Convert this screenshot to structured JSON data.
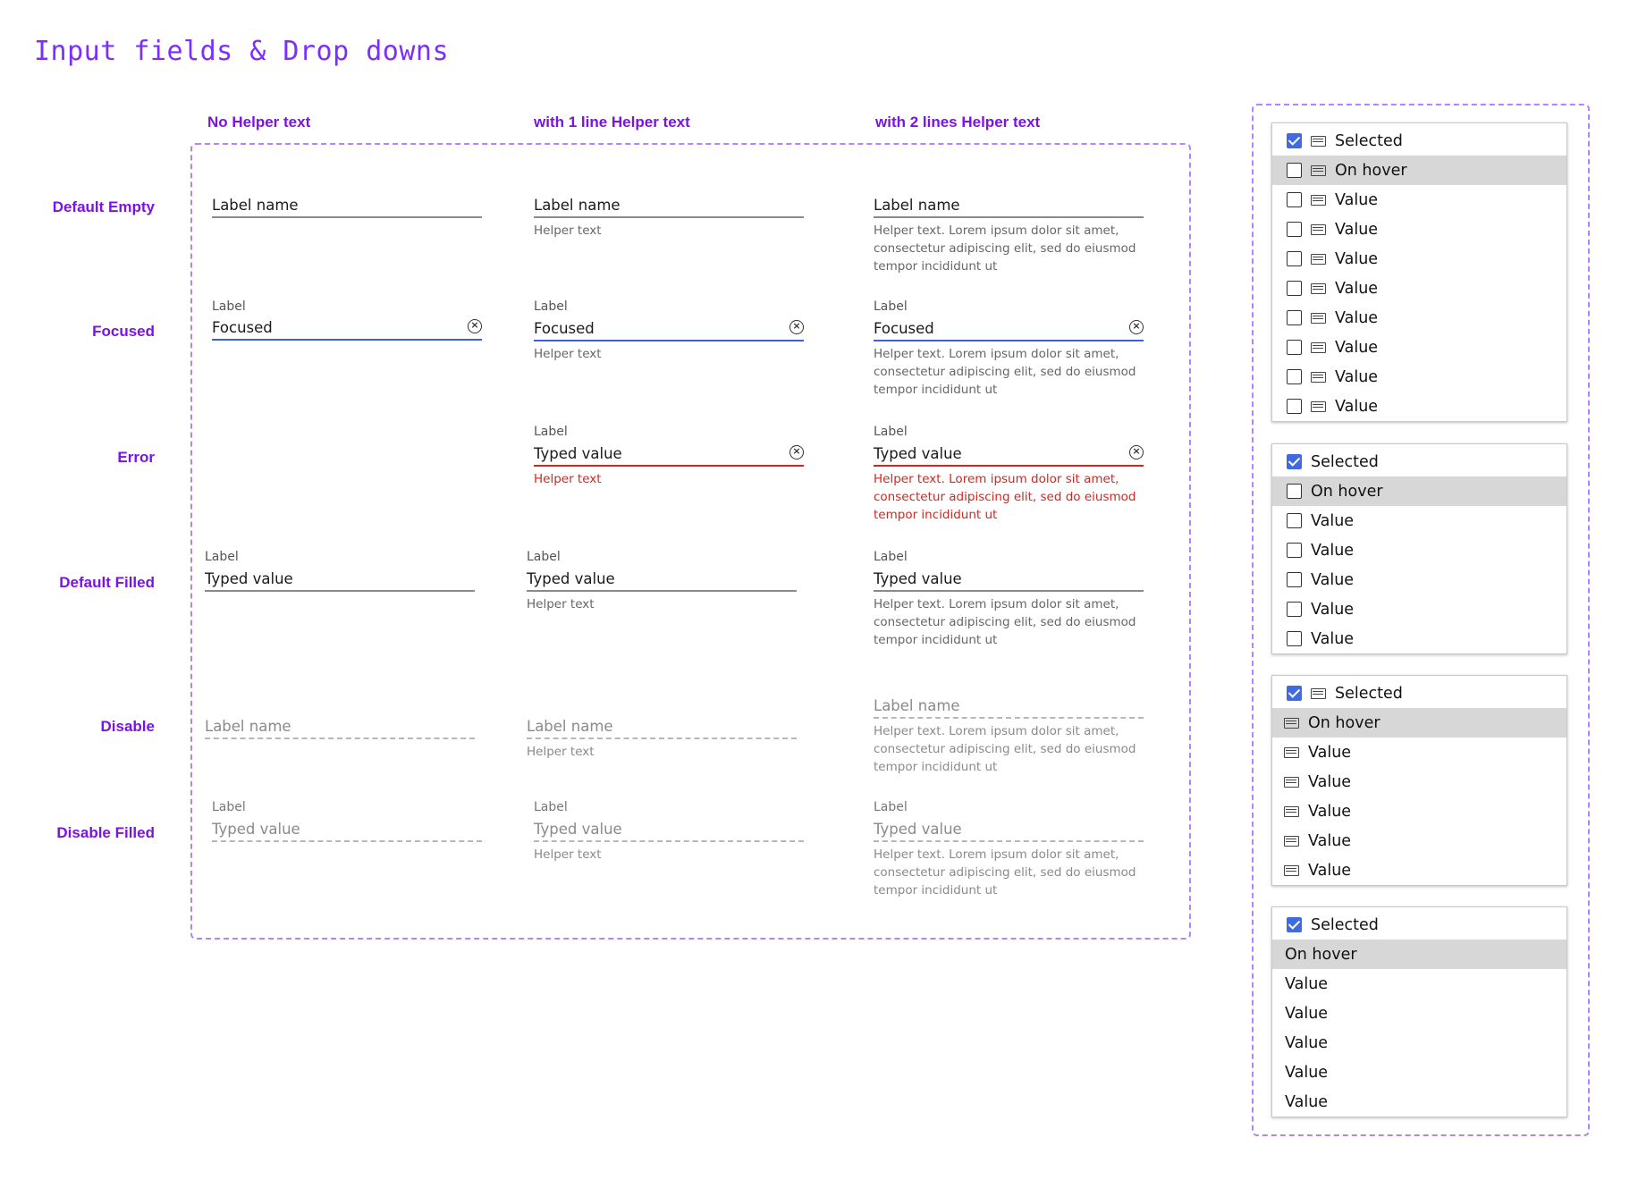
{
  "title": "Input fields & Drop downs",
  "columns": [
    "No Helper text",
    "with 1 line Helper text",
    "with 2 lines Helper text"
  ],
  "rows": [
    "Default Empty",
    "Focused",
    "Error",
    "Default Filled",
    "Disable",
    "Disable Filled"
  ],
  "text": {
    "label_name": "Label name",
    "label": "Label",
    "focused": "Focused",
    "typed_value": "Typed value",
    "helper_text": "Helper text",
    "helper_long_1": "Helper text. Lorem ipsum dolor sit amet,",
    "helper_long_2": "consectetur adipiscing elit, sed do eiusmod",
    "helper_long_3": "tempor incididunt ut"
  },
  "colors": {
    "accent": "#7b12e6",
    "focus": "#3f5fd8",
    "error": "#d8251c",
    "checkbox": "#3f6ae0",
    "hover": "#d7d7d7"
  },
  "icons": [
    "clear-circle-x-icon",
    "checkbox-icon",
    "folder-icon"
  ],
  "dropdowns": [
    {
      "variant": "checkbox+icon",
      "items": [
        "Selected",
        "On hover",
        "Value",
        "Value",
        "Value",
        "Value",
        "Value",
        "Value",
        "Value",
        "Value"
      ]
    },
    {
      "variant": "checkbox",
      "items": [
        "Selected",
        "On hover",
        "Value",
        "Value",
        "Value",
        "Value",
        "Value"
      ]
    },
    {
      "variant": "icon",
      "items": [
        "Selected",
        "On hover",
        "Value",
        "Value",
        "Value",
        "Value",
        "Value"
      ]
    },
    {
      "variant": "text",
      "items": [
        "Selected",
        "On hover",
        "Value",
        "Value",
        "Value",
        "Value",
        "Value"
      ]
    }
  ]
}
